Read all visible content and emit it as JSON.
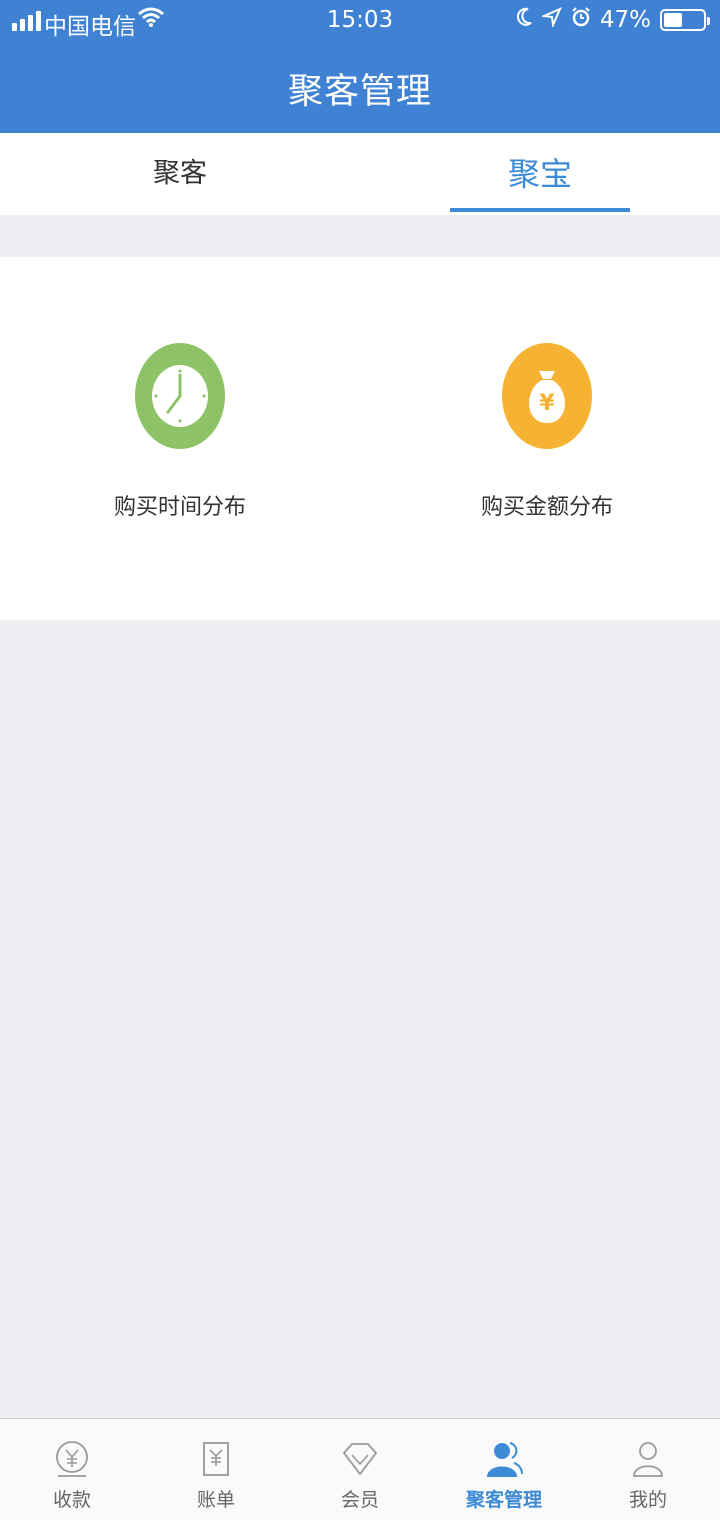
{
  "status_bar": {
    "carrier": "中国电信",
    "time": "15:03",
    "battery_percent": "47%",
    "battery_level": 0.47
  },
  "header": {
    "title": "聚客管理"
  },
  "tabs": [
    {
      "label": "聚客",
      "active": false
    },
    {
      "label": "聚宝",
      "active": true
    }
  ],
  "features": [
    {
      "label": "购买时间分布",
      "icon": "clock-icon",
      "color": "#8dc266"
    },
    {
      "label": "购买金额分布",
      "icon": "money-bag-icon",
      "color": "#f6b233",
      "symbol": "¥"
    }
  ],
  "bottom_nav": [
    {
      "label": "收款",
      "icon": "yen-coin-icon",
      "active": false
    },
    {
      "label": "账单",
      "icon": "bill-icon",
      "active": false
    },
    {
      "label": "会员",
      "icon": "diamond-icon",
      "active": false
    },
    {
      "label": "聚客管理",
      "icon": "users-icon",
      "active": true
    },
    {
      "label": "我的",
      "icon": "person-icon",
      "active": false
    }
  ],
  "colors": {
    "header_bg": "#3f82d3",
    "accent": "#3d8bd6",
    "page_bg": "#eeeff3"
  }
}
